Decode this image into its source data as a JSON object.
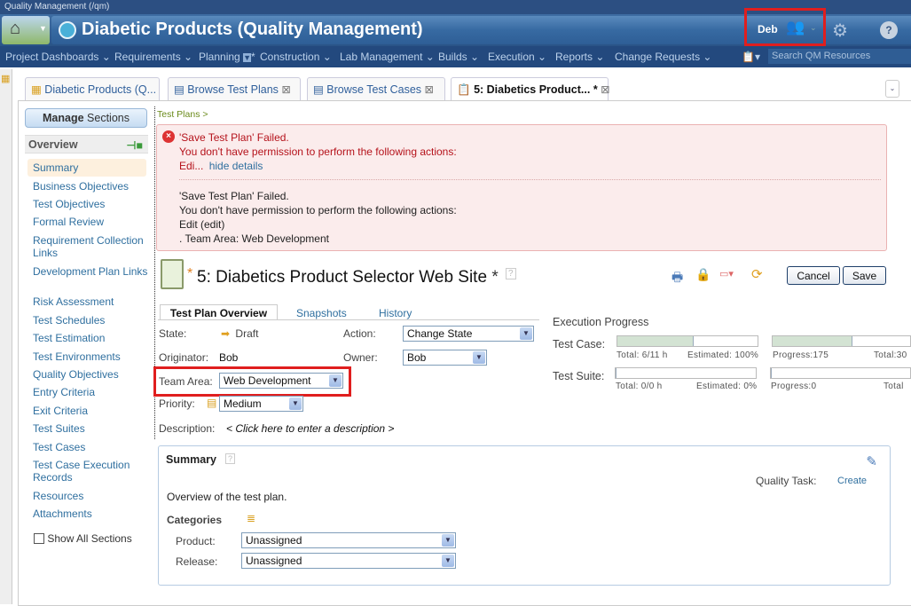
{
  "window": {
    "title": "Quality Management (/qm)"
  },
  "header": {
    "project_title": "Diabetic Products (Quality Management)",
    "user": "Deb"
  },
  "nav": {
    "items": [
      "Project Dashboards",
      "Requirements",
      "Planning",
      "Construction",
      "Lab Management",
      "Builds",
      "Execution",
      "Reports",
      "Change Requests"
    ],
    "search_placeholder": "Search QM Resources"
  },
  "tabs": [
    {
      "label": "Diabetic Products (Q..."
    },
    {
      "label": "Browse Test Plans"
    },
    {
      "label": "Browse Test Cases"
    },
    {
      "label": "5: Diabetics Product... *"
    }
  ],
  "sidebar": {
    "manage_bold": "Manage",
    "manage_rest": " Sections",
    "section": "Overview",
    "items": [
      "Summary",
      "Business Objectives",
      "Test Objectives",
      "Formal Review",
      "Requirement Collection Links",
      "Development Plan Links",
      "Risk Assessment",
      "Test Schedules",
      "Test Estimation",
      "Test Environments",
      "Quality Objectives",
      "Entry Criteria",
      "Exit Criteria",
      "Test Suites",
      "Test Cases",
      "Test Case Execution Records",
      "Resources",
      "Attachments"
    ],
    "show_all": "Show All Sections"
  },
  "breadcrumb": "Test Plans >",
  "error": {
    "line1": "'Save Test Plan' Failed.",
    "line2": "You don't have permission to perform the following actions:",
    "line3": "Edi...",
    "hide": "hide details",
    "d1": "'Save Test Plan' Failed.",
    "d2": "You don't have permission to perform the following actions:",
    "d3": "Edit (edit)",
    "d4": ". Team Area: Web Development"
  },
  "plan": {
    "title": "5: Diabetics Product Selector Web Site",
    "cancel": "Cancel",
    "save": "Save",
    "subtabs": [
      "Test Plan Overview",
      "Snapshots",
      "History"
    ],
    "state_label": "State:",
    "state": "Draft",
    "action_label": "Action:",
    "action": "Change State",
    "originator_label": "Originator:",
    "originator": "Bob",
    "owner_label": "Owner:",
    "owner": "Bob",
    "team_label": "Team Area:",
    "team": "Web Development",
    "priority_label": "Priority:",
    "priority": "Medium",
    "desc_label": "Description:",
    "desc": "< Click here to enter a description >"
  },
  "progress": {
    "title": "Execution Progress",
    "test_case_label": "Test Case:",
    "test_suite_label": "Test Suite:",
    "tc_total": "Total: 6/11 h",
    "tc_est": "Estimated: 100%",
    "tc_prog": "Progress:175",
    "tc_total2": "Total:30",
    "ts_total": "Total: 0/0 h",
    "ts_est": "Estimated: 0%",
    "ts_prog": "Progress:0",
    "ts_total2": "Total",
    "tc_hours_fraction": 0.545,
    "tc_points_fraction": 0.58,
    "ts_fraction": 0
  },
  "summary": {
    "title": "Summary",
    "desc": "Overview of the test plan.",
    "quality_task": "Quality Task:",
    "create": "Create",
    "categories": "Categories",
    "product_label": "Product:",
    "product": "Unassigned",
    "release_label": "Release:",
    "release": "Unassigned"
  }
}
